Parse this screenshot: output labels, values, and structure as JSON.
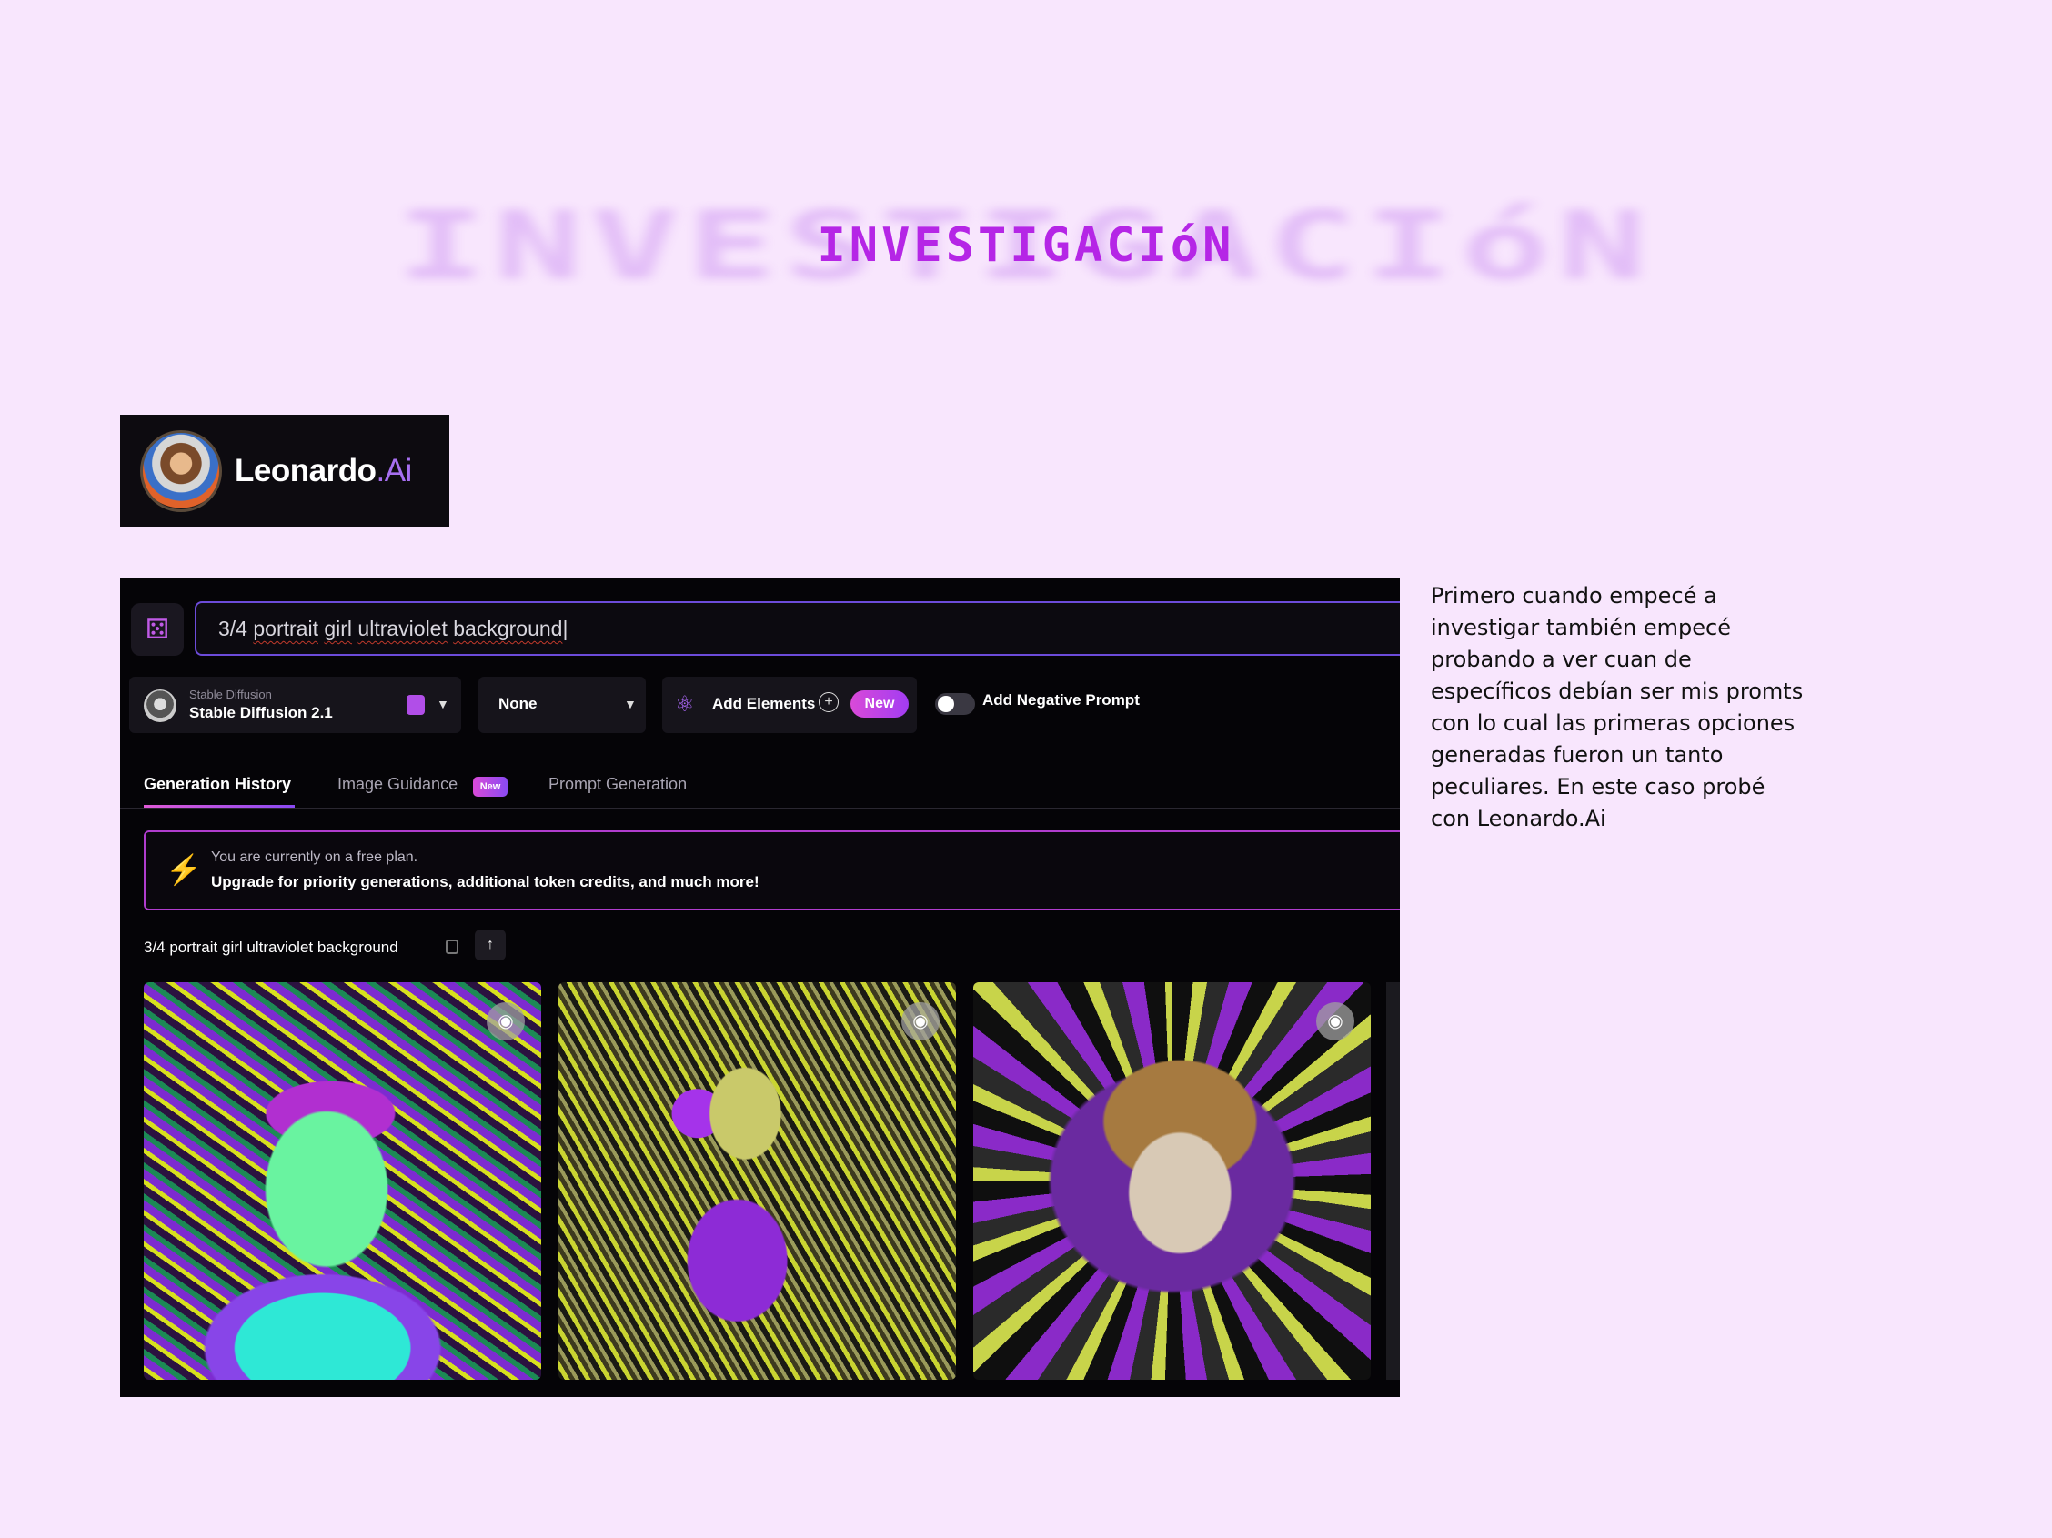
{
  "heading": {
    "title": "INVESTIGACIóN"
  },
  "logo": {
    "name": "Leonardo",
    "dot": ".",
    "suffix": "Ai"
  },
  "app": {
    "prompt": {
      "prefix": "3/4 ",
      "w1": "portrait",
      "w2": "girl",
      "w3": "ultraviolet",
      "w4": "background"
    },
    "model": {
      "provider": "Stable Diffusion",
      "name": "Stable Diffusion 2.1"
    },
    "style_select": {
      "value": "None"
    },
    "elements": {
      "label": "Add Elements",
      "badge": "New"
    },
    "negative_prompt": {
      "label": "Add Negative Prompt",
      "enabled": false
    },
    "tabs": [
      {
        "label": "Generation History",
        "active": true
      },
      {
        "label": "Image Guidance",
        "badge": "New"
      },
      {
        "label": "Prompt Generation"
      }
    ],
    "banner": {
      "line1": "You are currently on a free plan.",
      "line2": "Upgrade for priority generations, additional token credits, and much more!"
    },
    "history": {
      "title": "3/4 portrait girl ultraviolet background"
    }
  },
  "description": "Primero cuando empecé a investigar también empecé probando a ver cuan de específicos debían ser mis promts con lo cual las primeras opciones generadas fueron un tanto peculiares. En este caso probé con Leonardo.Ai",
  "icons": {
    "dice": "dice-icon",
    "model_badge": "model-style-icon",
    "elements": "atom-icon",
    "plus": "plus-circle-icon",
    "bolt": "lightning-icon",
    "copy": "copy-icon",
    "up": "arrow-up-icon",
    "eye": "eye-icon"
  }
}
